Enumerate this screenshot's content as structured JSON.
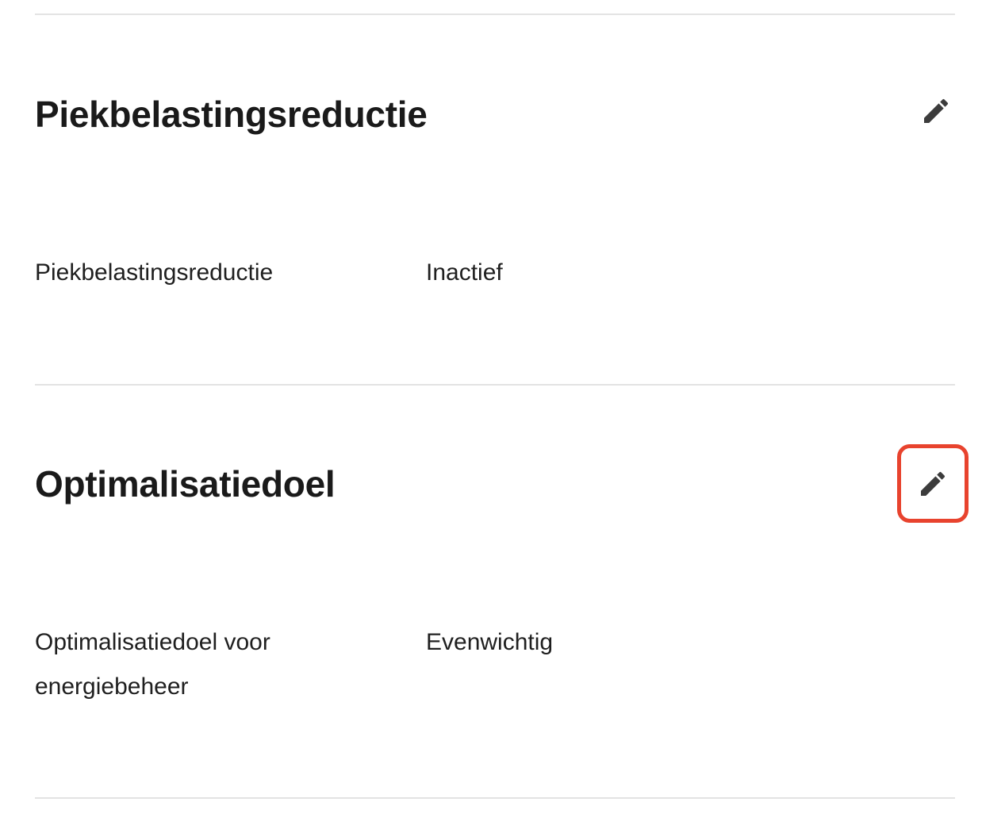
{
  "sections": [
    {
      "title": "Piekbelastingsreductie",
      "edit_icon": "pencil-icon",
      "row": {
        "label": "Piekbelastingsreductie",
        "value": "Inactief"
      }
    },
    {
      "title": "Optimalisatiedoel",
      "edit_icon": "pencil-icon",
      "edit_highlighted": true,
      "row": {
        "label": "Optimalisatiedoel voor energiebeheer",
        "value": "Evenwichtig"
      }
    }
  ],
  "colors": {
    "focus_ring": "#e8432e",
    "divider": "#e3e3e3",
    "text": "#1f1f1f",
    "icon": "#3c3c3c"
  }
}
